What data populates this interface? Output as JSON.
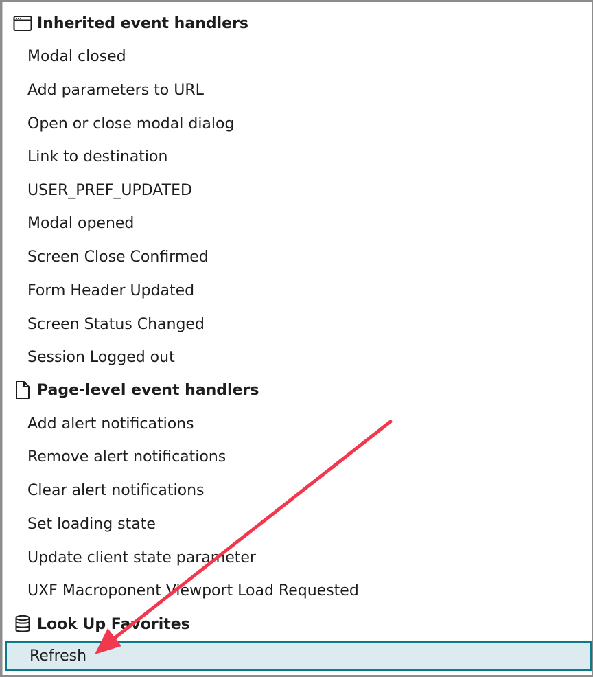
{
  "groups": [
    {
      "label": "Inherited event handlers",
      "icon": "window-icon",
      "items": [
        "Modal closed",
        "Add parameters to URL",
        "Open or close modal dialog",
        "Link to destination",
        "USER_PREF_UPDATED",
        "Modal opened",
        "Screen Close Confirmed",
        "Form Header Updated",
        "Screen Status Changed",
        "Session Logged out"
      ]
    },
    {
      "label": "Page-level event handlers",
      "icon": "document-icon",
      "items": [
        "Add alert notifications",
        "Remove alert notifications",
        "Clear alert notifications",
        "Set loading state",
        "Update client state parameter",
        "UXF Macroponent Viewport Load Requested"
      ]
    },
    {
      "label": "Look Up Favorites",
      "icon": "database-icon",
      "items": [
        "Refresh"
      ]
    }
  ],
  "selected_item": "Refresh",
  "colors": {
    "selected_bg": "#dcebf0",
    "selected_border": "#0b7b8c",
    "annotation_arrow": "#f0384f"
  }
}
